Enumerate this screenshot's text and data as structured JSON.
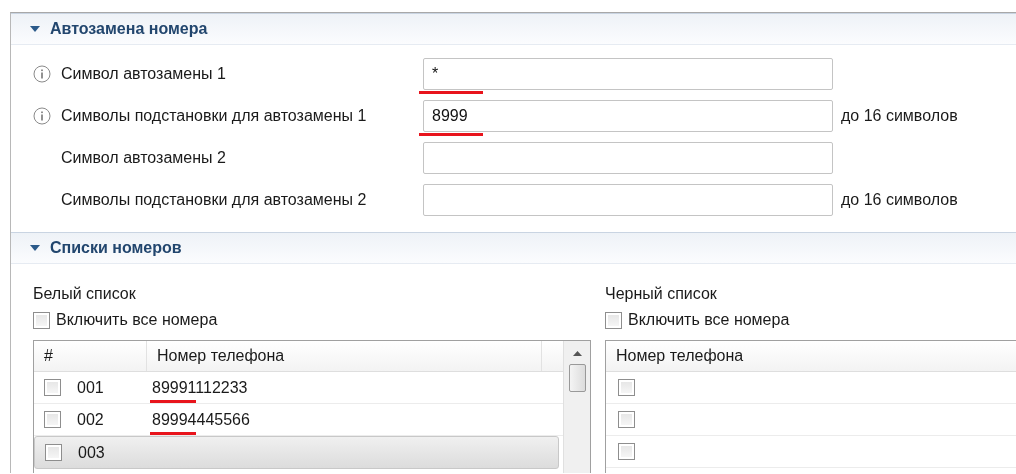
{
  "sections": [
    {
      "kind": "form",
      "title": "Автозамена номера",
      "expanded": true,
      "fields": [
        {
          "label": "Символ автозамены 1",
          "value": "*",
          "info": true,
          "underlined": true
        },
        {
          "label": "Символы подстановки для автозамены 1",
          "value": "8999",
          "hint": "до 16 символов",
          "info": true,
          "underlined": true
        },
        {
          "label": "Символ автозамены 2",
          "info": false,
          "underlined": false
        },
        {
          "label": "Символы подстановки для автозамены 2",
          "hint": "до 16 символов",
          "info": false,
          "underlined": false
        }
      ]
    },
    {
      "kind": "lists",
      "title": "Списки номеров",
      "expanded": true,
      "lists": [
        {
          "title": "Белый список",
          "include_all": {
            "label": "Включить все номера",
            "checked": false
          },
          "table": {
            "kind": "numbered",
            "columns": [
              "#",
              "Номер телефона"
            ],
            "rows": [
              {
                "number": "001",
                "checked": false,
                "phone": "89991112233",
                "underlined": true,
                "selected": false
              },
              {
                "number": "002",
                "checked": false,
                "phone": "89994445566",
                "underlined": true,
                "selected": false
              },
              {
                "number": "003",
                "checked": false,
                "underlined": false,
                "selected": true
              }
            ]
          }
        },
        {
          "title": "Черный список",
          "include_all": {
            "label": "Включить все номера",
            "checked": false
          },
          "table": {
            "kind": "plain",
            "columns": [
              "Номер телефона"
            ],
            "rows": [
              {
                "checked": false,
                "selected": false
              },
              {
                "checked": false,
                "selected": false
              },
              {
                "checked": false,
                "selected": false
              }
            ]
          }
        }
      ]
    }
  ]
}
